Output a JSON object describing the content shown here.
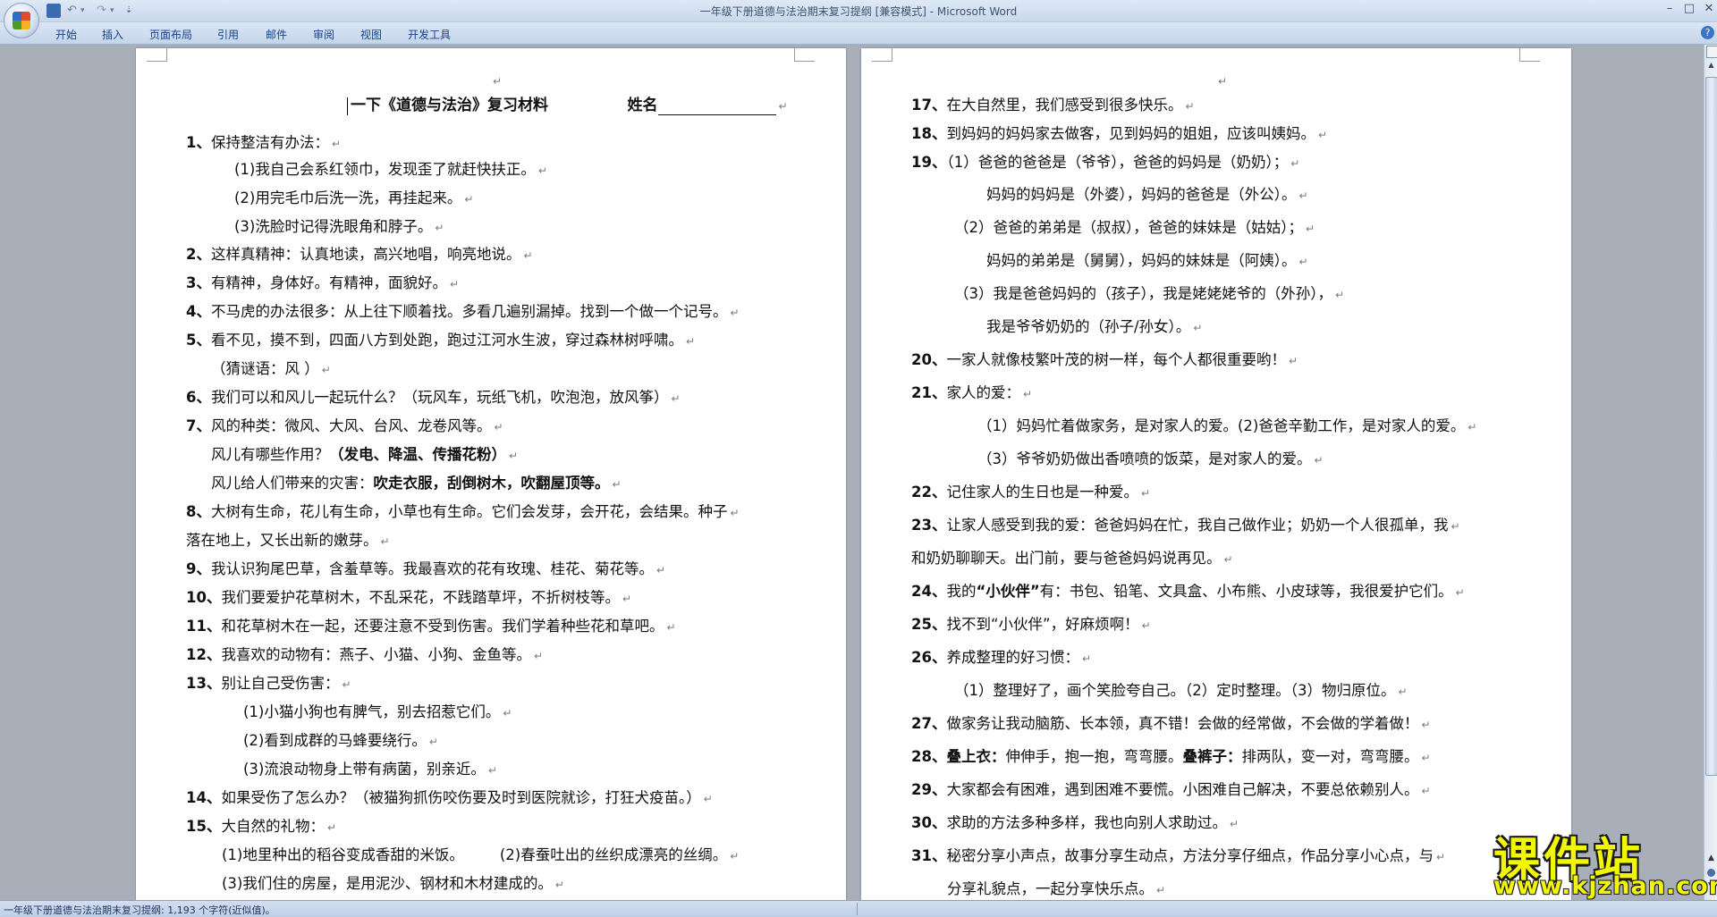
{
  "window": {
    "title": "一年级下册道德与法治期末复习提纲 [兼容模式] - Microsoft Word",
    "controls": {
      "minimize": "–",
      "maximize": "□",
      "close": "✕"
    }
  },
  "quick_access": {
    "undo": "↶",
    "redo": "↷",
    "dropdown": "▾",
    "more": "⇣"
  },
  "ribbon": {
    "tabs": [
      "开始",
      "插入",
      "页面布局",
      "引用",
      "邮件",
      "审阅",
      "视图",
      "开发工具"
    ],
    "help": "?"
  },
  "document": {
    "title": "一下《道德与法治》复习材料",
    "name_label": "姓名",
    "left_lines": [
      {
        "num": "1、",
        "text": "保持整洁有办法："
      },
      {
        "num": "",
        "text": "(1)我自己会系红领巾，发现歪了就赶快扶正。"
      },
      {
        "num": "",
        "text": "(2)用完毛巾后洗一洗，再挂起来。"
      },
      {
        "num": "",
        "text": "(3)洗脸时记得洗眼角和脖子。"
      },
      {
        "num": "2、",
        "text": "这样真精神：认真地读，高兴地唱，响亮地说。"
      },
      {
        "num": "3、",
        "text": "有精神，身体好。有精神，面貌好。"
      },
      {
        "num": "4、",
        "text": "不马虎的办法很多：从上往下顺着找。多看几遍别漏掉。找到一个做一个记号。"
      },
      {
        "num": "5、",
        "text": "看不见，摸不到，四面八方到处跑，跑过江河水生波，穿过森林树呼啸。"
      },
      {
        "num": "",
        "text": "（猜谜语：风 ）"
      },
      {
        "num": "6、",
        "text": "我们可以和风儿一起玩什么？（玩风车，玩纸飞机，吹泡泡，放风筝）"
      },
      {
        "num": "7、",
        "text": "风的种类：微风、大风、台风、龙卷风等。"
      },
      {
        "num": "",
        "text": "风儿有哪些作用？",
        "bold": "（发电、降温、传播花粉）"
      },
      {
        "num": "",
        "text": "风儿给人们带来的灾害：",
        "bold": "吹走衣服，刮倒树木，吹翻屋顶等。"
      },
      {
        "num": "8、",
        "text": "大树有生命，花儿有生命，小草也有生命。它们会发芽，会开花，会结果。种子"
      },
      {
        "num": "",
        "text": "落在地上，又长出新的嫩芽。"
      },
      {
        "num": "9、",
        "text": "我认识狗尾巴草，含羞草等。我最喜欢的花有玫瑰、桂花、菊花等。"
      },
      {
        "num": "10、",
        "text": "我们要爱护花草树木，不乱采花，不践踏草坪，不折树枝等。"
      },
      {
        "num": "11、",
        "text": "和花草树木在一起，还要注意不受到伤害。我们学着种些花和草吧。"
      },
      {
        "num": "12、",
        "text": "我喜欢的动物有：燕子、小猫、小狗、金鱼等。"
      },
      {
        "num": "13、",
        "text": "别让自己受伤害："
      },
      {
        "num": "",
        "text": "(1)小猫小狗也有脾气，别去招惹它们。"
      },
      {
        "num": "",
        "text": "(2)看到成群的马蜂要绕行。"
      },
      {
        "num": "",
        "text": "(3)流浪动物身上带有病菌，别亲近。"
      },
      {
        "num": "14、",
        "text": "如果受伤了怎么办？（被猫狗抓伤咬伤要及时到医院就诊，打狂犬疫苗。）"
      },
      {
        "num": "15、",
        "text": "大自然的礼物："
      },
      {
        "num": "",
        "text": "(1)地里种出的稻谷变成香甜的米饭。",
        "extra": "(2)春蚕吐出的丝织成漂亮的丝绸。"
      },
      {
        "num": "",
        "text": "(3)我们住的房屋，是用泥沙、钢材和木材建成的。"
      }
    ],
    "right_lines": [
      {
        "num": "17、",
        "text": "在大自然里，我们感受到很多快乐。"
      },
      {
        "num": "18、",
        "text": "到妈妈的妈妈家去做客，见到妈妈的姐姐，应该叫姨妈。"
      },
      {
        "num": "19、",
        "text": "（1）爸爸的爸爸是（爷爷），爸爸的妈妈是（奶奶）；"
      },
      {
        "num": "",
        "text": "妈妈的妈妈是（外婆），妈妈的爸爸是（外公）。"
      },
      {
        "num": "",
        "text": "（2）爸爸的弟弟是（叔叔），爸爸的妹妹是（姑姑）；"
      },
      {
        "num": "",
        "text": "妈妈的弟弟是（舅舅），妈妈的妹妹是（阿姨）。"
      },
      {
        "num": "",
        "text": "（3）我是爸爸妈妈的（孩子），我是姥姥姥爷的（外孙），"
      },
      {
        "num": "",
        "text": "我是爷爷奶奶的（孙子/孙女）。"
      },
      {
        "num": "20、",
        "text": "一家人就像枝繁叶茂的树一样，每个人都很重要哟！"
      },
      {
        "num": "21、",
        "text": "家人的爱："
      },
      {
        "num": "",
        "text": "（1）妈妈忙着做家务，是对家人的爱。(2)爸爸辛勤工作，是对家人的爱。"
      },
      {
        "num": "",
        "text": "（3）爷爷奶奶做出香喷喷的饭菜，是对家人的爱。"
      },
      {
        "num": "22、",
        "text": "记住家人的生日也是一种爱。"
      },
      {
        "num": "23、",
        "text": "让家人感受到我的爱：爸爸妈妈在忙，我自己做作业；奶奶一个人很孤单，我"
      },
      {
        "num": "",
        "text": "和奶奶聊聊天。出门前，要与爸爸妈妈说再见。"
      },
      {
        "num": "24、",
        "text": "我的",
        "bold": "“小伙伴”",
        "extra": "有：书包、铅笔、文具盒、小布熊、小皮球等，我很爱护它们。"
      },
      {
        "num": "25、",
        "text": "找不到“小伙伴”，好麻烦啊！"
      },
      {
        "num": "26、",
        "text": "养成整理的好习惯："
      },
      {
        "num": "",
        "text": "（1）整理好了，画个笑脸夸自己。（2）定时整理。（3）物归原位。"
      },
      {
        "num": "27、",
        "text": "做家务让我动脑筋、长本领，真不错！会做的经常做，不会做的学着做！"
      },
      {
        "num": "28、",
        "bold": "叠上衣：",
        "text": "伸伸手，抱一抱，弯弯腰。",
        "bold2": "叠裤子：",
        "extra": "排两队，变一对，弯弯腰。"
      },
      {
        "num": "29、",
        "text": "大家都会有困难，遇到困难不要慌。小困难自己解决，不要总依赖别人。"
      },
      {
        "num": "30、",
        "text": "求助的方法多种多样，我也向别人求助过。"
      },
      {
        "num": "31、",
        "text": "秘密分享小声点，故事分享生动点，方法分享仔细点，作品分享小心点，与"
      },
      {
        "num": "",
        "text": "分享礼貌点，一起分享快乐点。"
      }
    ]
  },
  "status_bar": {
    "text": "一年级下册道德与法治期末复习提纲: 1,193 个字符(近似值)。"
  },
  "scrollbar": {
    "up": "▲",
    "prev": "▲",
    "next": "▼"
  },
  "watermark": {
    "title": "课件站",
    "url": "www.kjzhan.com"
  },
  "paragraph_mark": "↵"
}
